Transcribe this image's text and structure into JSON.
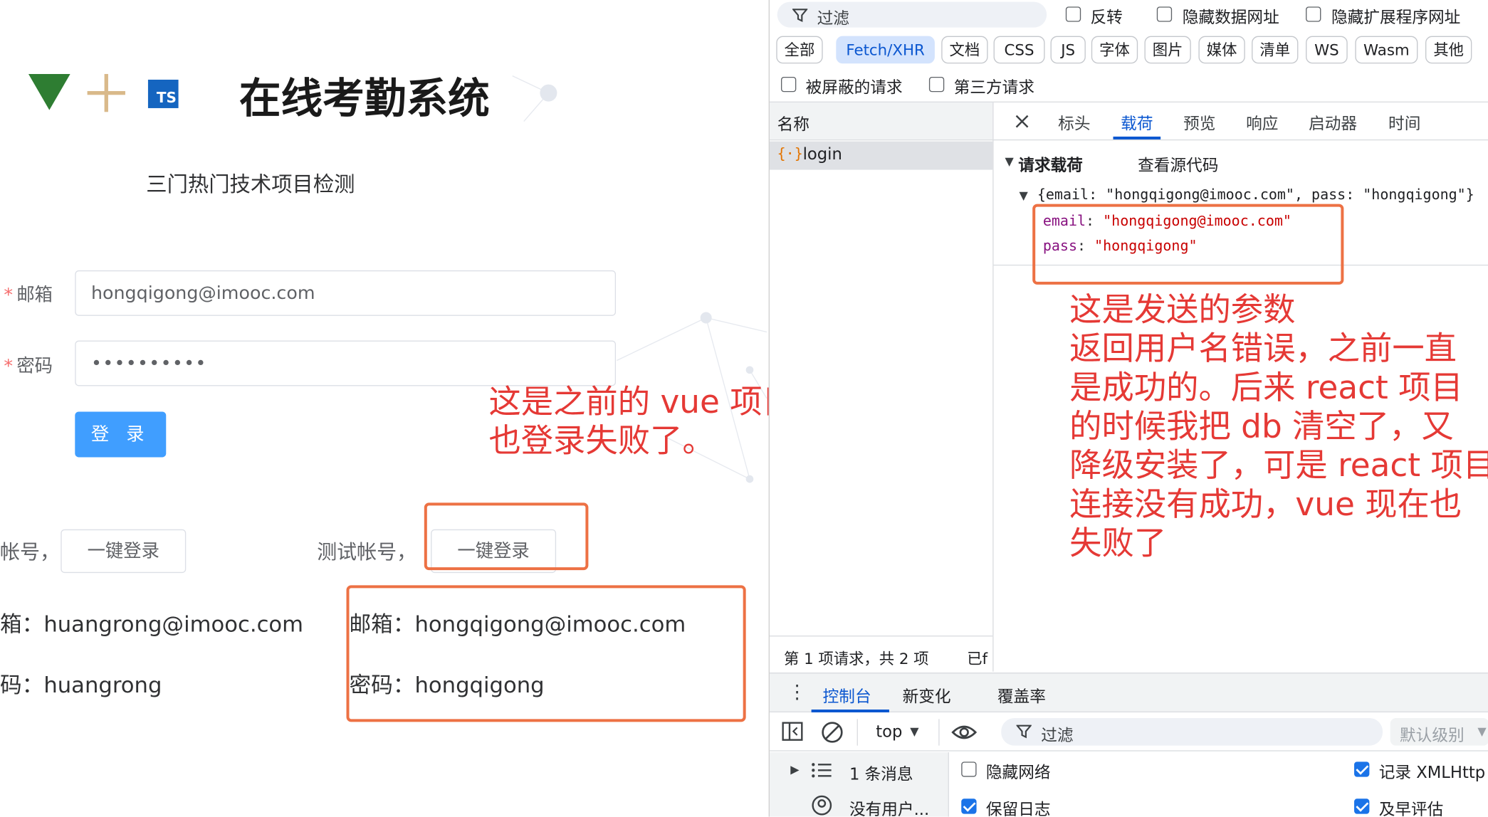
{
  "app": {
    "title": "在线考勤系统",
    "subtitle": "三门热门技术项目检测",
    "ts_badge": "TS",
    "form": {
      "email_label": "邮箱",
      "email_value": "hongqigong@imooc.com",
      "password_label": "密码",
      "password_value": "••••••••••",
      "login_button": "登 录"
    },
    "test_accounts": [
      {
        "label": "帐号，",
        "button": "一键登录",
        "email_line": "箱：huangrong@imooc.com",
        "password_line": "码：huangrong"
      },
      {
        "label": "测试帐号，",
        "button": "一键登录",
        "email_line": "邮箱：hongqigong@imooc.com",
        "password_line": "密码：hongqigong"
      }
    ]
  },
  "annotations": {
    "left_note": [
      "这是之前的 vue 项目，",
      "也登录失败了。"
    ],
    "right_note": [
      "这是发送的参数",
      "返回用户名错误，之前一直",
      "是成功的。后来 react 项目",
      "的时候我把 db 清空了，又",
      "降级安装了，可是 react 项目",
      "连接没有成功，vue 现在也",
      "失败了"
    ]
  },
  "devtools": {
    "filter_placeholder": "过滤",
    "invert_label": "反转",
    "hide_data_urls_label": "隐藏数据网址",
    "hide_ext_urls_label": "隐藏扩展程序网址",
    "type_filters": [
      "全部",
      "Fetch/XHR",
      "文档",
      "CSS",
      "JS",
      "字体",
      "图片",
      "媒体",
      "清单",
      "WS",
      "Wasm",
      "其他"
    ],
    "active_type_filter": "Fetch/XHR",
    "blocked_requests_label": "被屏蔽的请求",
    "third_party_label": "第三方请求",
    "name_column": "名称",
    "requests": [
      {
        "name": "login"
      }
    ],
    "detail_tabs": [
      "标头",
      "载荷",
      "预览",
      "响应",
      "启动器",
      "时间"
    ],
    "active_detail_tab": "载荷",
    "payload_section": "请求载荷",
    "view_source": "查看源代码",
    "payload_summary": "{email: \"hongqigong@imooc.com\", pass: \"hongqigong\"}",
    "payload_fields": [
      {
        "key": "email",
        "value": "\"hongqigong@imooc.com\""
      },
      {
        "key": "pass",
        "value": "\"hongqigong\""
      }
    ],
    "status_bar": "第 1 项请求，共 2 项",
    "status_bar_more": "已f",
    "drawer_tabs": [
      "控制台",
      "新变化",
      "覆盖率"
    ],
    "active_drawer_tab": "控制台",
    "console": {
      "context": "top",
      "filter_placeholder": "过滤",
      "level": "默认级别",
      "sidebar": [
        "1 条消息",
        "没有用户..."
      ],
      "settings": [
        {
          "label": "隐藏网络",
          "checked": false
        },
        {
          "label": "保留日志",
          "checked": true
        }
      ],
      "settings_right": [
        {
          "label": "记录 XMLHttp",
          "checked": true
        },
        {
          "label": "及早评估",
          "checked": true
        }
      ]
    }
  }
}
